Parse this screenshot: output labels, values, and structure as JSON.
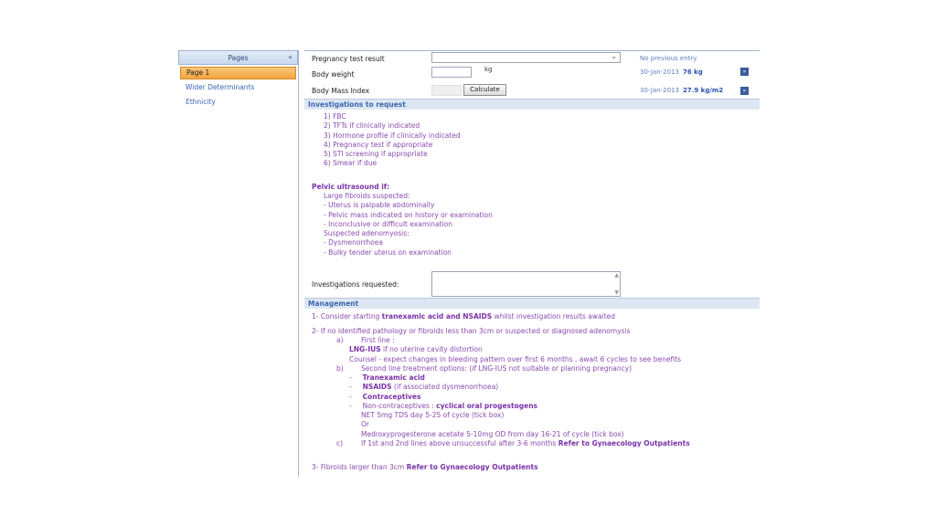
{
  "nav": {
    "title": "Pages",
    "collapse_icon": "«",
    "items": [
      {
        "label": "Page 1",
        "active": true
      },
      {
        "label": "Wider Determinants",
        "active": false
      },
      {
        "label": "Ethnicity",
        "active": false
      }
    ]
  },
  "form": {
    "pregnancy": {
      "label": "Pregnancy test result",
      "value": "",
      "previous": "No previous entry"
    },
    "weight": {
      "label": "Body weight",
      "value": "",
      "unit": "kg",
      "prev_date": "30-Jan-2013",
      "prev_value": "76 kg"
    },
    "bmi": {
      "label": "Body Mass Index",
      "button": "Calculate",
      "prev_date": "30-Jan-2013",
      "prev_value": "27.9 kg/m2"
    },
    "go_icon": "»"
  },
  "investigations": {
    "header": "Investigations to request",
    "list": [
      "1)    FBC",
      "2)    TFTs if clinically indicated",
      "3)    Hormone profile if clinically indicated",
      "4)    Pregnancy test if appropriate",
      "5)    STI screening if appropriate",
      "6)    Smear if due"
    ],
    "pelvic_title": "Pelvic ultrasound if:",
    "large_fibroids": "Large fibroids suspected:",
    "fibroid_items": [
      "-      Uterus is palpable abdominally",
      "-      Pelvic mass indicated on history or examination",
      "-      Inconclusive or difficult examination"
    ],
    "adenomyosis": "Suspected adenomyosis:",
    "adeno_items": [
      "-      Dysmenorrhoea",
      "-      Bulky tender uterus on examination"
    ],
    "requested_label": "Investigations requested:"
  },
  "management": {
    "header": "Management",
    "item1_pre": "1- Consider starting ",
    "item1_bold": "tranexamic acid and NSAIDS",
    "item1_post": " whilst investigation results awaited",
    "item2": "2- If no identified pathology or fibroids less than 3cm or suspected or diagnosed adenomysis",
    "a_marker": "a)",
    "a_text": "First line :",
    "lng_bold": "LNG-IUS",
    "lng_post": " if no uterine cavity distortion",
    "counsel": "Counsel - expect changes in bleeding pattern over first 6 months , await 6 cycles to see benefits",
    "b_marker": "b)",
    "b_text": "Second line treatment options: (if LNG-IUS not suitable or planning pregnancy)",
    "opt_tranexamic": "Tranexamic acid",
    "opt_nsaids": "NSAIDS",
    "opt_nsaids_post": " (if associated dysmenorrhoea)",
    "opt_contraceptives": "Contraceptives",
    "opt_noncontra_pre": "Non-contraceptives : ",
    "opt_noncontra_bold": "cyclical oral progestogens",
    "net": "NET 5mg TDS day 5-25 of cycle (tick box)",
    "or": "Or",
    "medroxy": "Medroxyprogesterone acetate 5-10mg OD from day 16-21 of cycle (tick box)",
    "c_marker": "c)",
    "c_pre": "If 1st and 2nd lines above unsuccessful after 3-6 months ",
    "c_bold": "Refer to Gynaecology Outpatients",
    "item3_pre": "3- Fibroids larger than 3cm ",
    "item3_bold": "Refer to Gynaecology Outpatients"
  }
}
